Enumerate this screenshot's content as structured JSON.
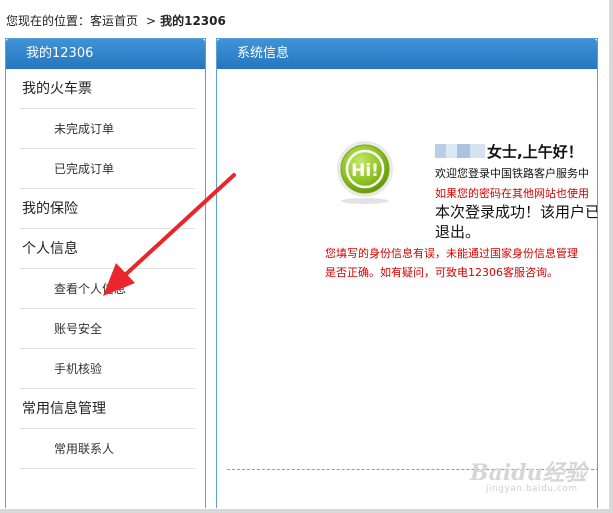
{
  "breadcrumb": {
    "prefix": "您现在的位置：",
    "home": "客运首页",
    "separator": ">",
    "current": "我的12306"
  },
  "sidebar": {
    "title": "我的12306",
    "items": [
      {
        "label": "我的火车票",
        "level": "top"
      },
      {
        "label": "未完成订单",
        "level": "sub"
      },
      {
        "label": "已完成订单",
        "level": "sub"
      },
      {
        "label": "我的保险",
        "level": "top"
      },
      {
        "label": "个人信息",
        "level": "top"
      },
      {
        "label": "查看个人信息",
        "level": "sub"
      },
      {
        "label": "账号安全",
        "level": "sub"
      },
      {
        "label": "手机核验",
        "level": "sub"
      },
      {
        "label": "常用信息管理",
        "level": "top"
      },
      {
        "label": "常用联系人",
        "level": "sub"
      }
    ]
  },
  "main": {
    "title": "系统信息",
    "hi_text": "Hi!",
    "greeting": "女士,上午好！",
    "welcome": "欢迎您登录中国铁路客户服务中",
    "password_warning": "如果您的密码在其他网站也使用",
    "login_success": "本次登录成功！该用户已",
    "logout": "退出。",
    "id_notice_line1": "您填写的身份信息有误，未能通过国家身份信息管理",
    "id_notice_line2": "是否正确。如有疑问，可致电12306客服咨询。"
  },
  "watermark": {
    "text": "Baidu经验",
    "sub": "jingyan.baidu.com"
  },
  "colors": {
    "panel_header": "#2f86cd",
    "panel_border": "#5aa0d8",
    "warning_red": "#d40000",
    "hi_green": "#8dc21f",
    "arrow_red": "#e8262b"
  },
  "icons": {
    "hi": "hi-greeting-icon",
    "arrow": "red-arrow-annotation"
  }
}
